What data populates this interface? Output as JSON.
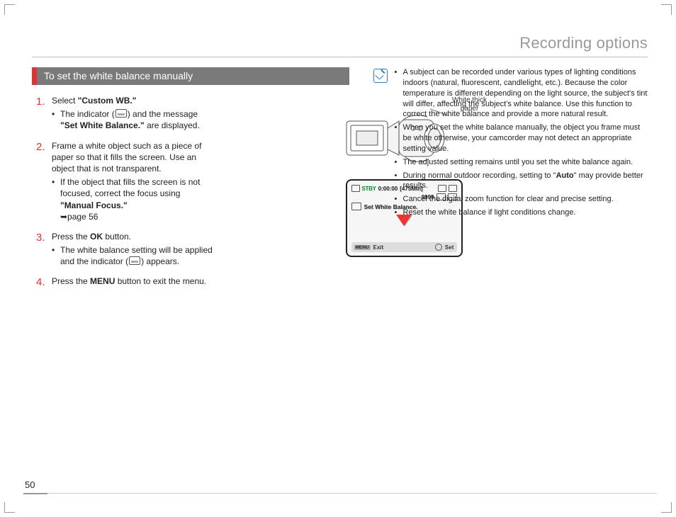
{
  "header": {
    "title": "Recording options"
  },
  "section": {
    "title": "To set the white balance manually"
  },
  "steps": {
    "s1": {
      "prefix": "Select ",
      "bold": "\"Custom WB.\"",
      "sub1a": "The indicator (",
      "sub1b": ") and the message ",
      "sub1c": "\"Set White Balance.\"",
      "sub1d": " are displayed."
    },
    "s2": {
      "text": "Frame a white object such as a piece of paper so that it fills the screen. Use an object that is not transparent.",
      "sub1a": "If the object that fills the screen is not focused, correct the focus using ",
      "sub1b": "\"Manual Focus.\"",
      "sub1c": " ➥page 56"
    },
    "s3": {
      "prefix": "Press the ",
      "bold": "OK",
      "suffix": " button.",
      "sub1a": "The white balance setting will be applied and the indicator (",
      "sub1b": ") appears."
    },
    "s4": {
      "prefix": "Press the ",
      "bold": "MENU",
      "suffix": " button to exit the menu."
    }
  },
  "illus": {
    "label_line1": "White thick",
    "label_line2": "paper"
  },
  "lcd": {
    "stby": "STBY",
    "timecode": "0:00:00",
    "remain": "[475Min]",
    "counter": "9999",
    "message": "Set White Balance.",
    "menu_tag": "MENU",
    "exit": "Exit",
    "set": "Set"
  },
  "tips": {
    "t1": "A subject can be recorded under various types of lighting conditions indoors (natural, fluorescent, candlelight, etc.). Because the color temperature is different depending on the light source, the subject's tint will differ, affecting the subject's white balance. Use this function to correct the white balance and provide a more natural result.",
    "t2": "When you set the white balance manually, the object you frame must be white otherwise, your camcorder may not detect an appropriate setting value.",
    "t3": "The adjusted setting remains until you set the white balance again.",
    "t4a": "During normal outdoor recording, setting to \"",
    "t4b": "Auto",
    "t4c": "\" may provide better results.",
    "t5": "Cancel the digital zoom function for clear and precise setting.",
    "t6": "Reset the white balance if light conditions change."
  },
  "page_number": "50"
}
